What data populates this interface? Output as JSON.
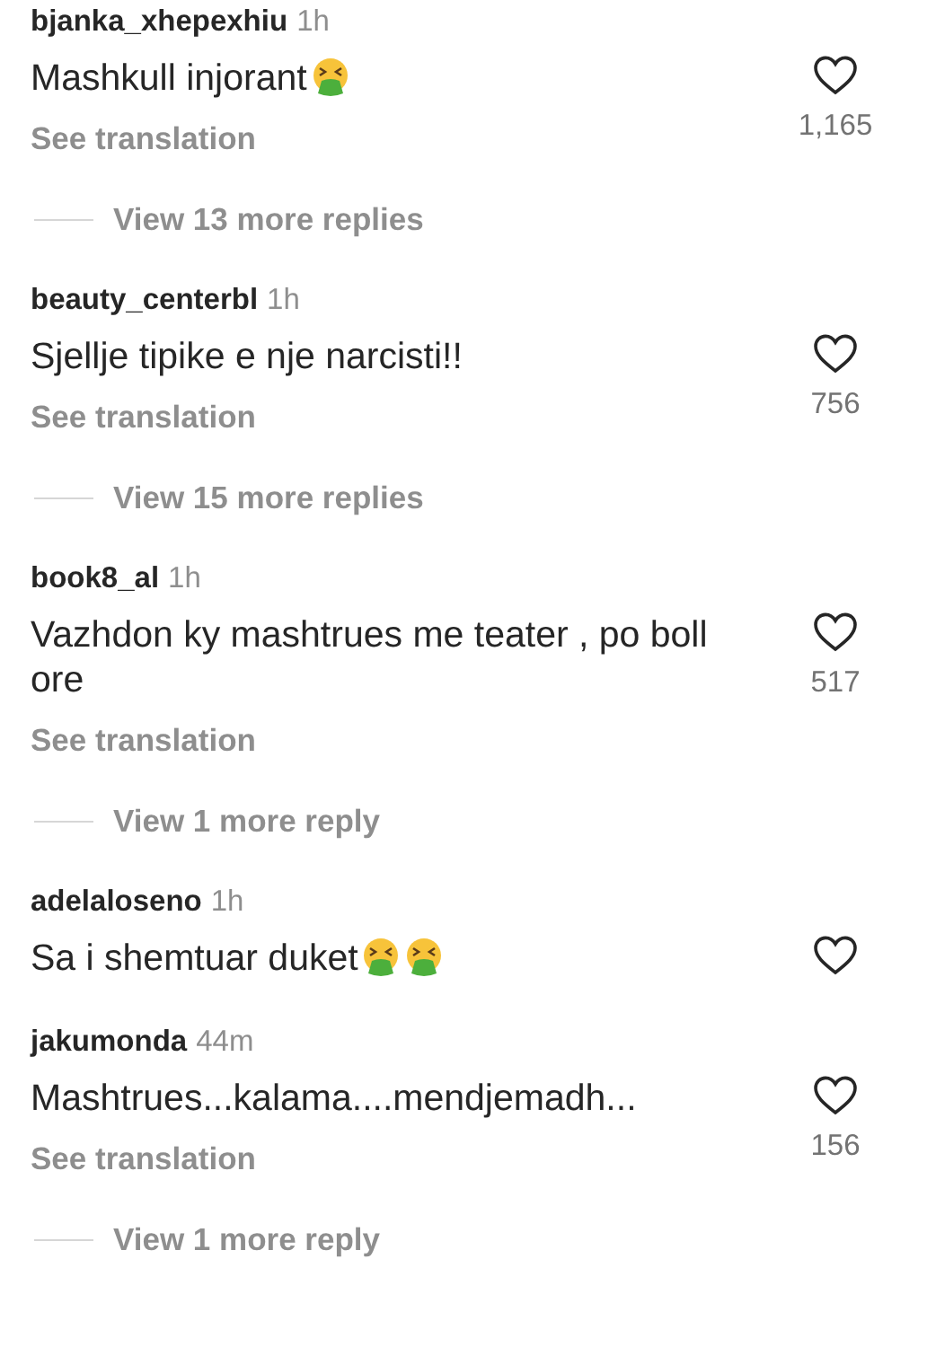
{
  "comments": [
    {
      "username": "bjanka_xhepexhiu",
      "time": "1h",
      "text": "Mashkull injorant",
      "emoji_icons": [
        {
          "kind": "vomit"
        }
      ],
      "liked": false,
      "likes": "1,165",
      "translation": "See translation",
      "replies": "View 13 more replies"
    },
    {
      "username": "beauty_centerbl",
      "time": "1h",
      "text": "Sjellje tipike e nje narcisti!!",
      "liked": false,
      "likes": "756",
      "translation": "See translation",
      "replies": "View 15 more replies"
    },
    {
      "username": "book8_al",
      "time": "1h",
      "text": "Vazhdon ky mashtrues me teater , po boll ore",
      "liked": false,
      "likes": "517",
      "translation": "See translation",
      "replies": "View 1 more reply"
    },
    {
      "username": "adelaloseno",
      "time": "1h",
      "text": "Sa i shemtuar duket",
      "emoji_icons": [
        {
          "kind": "vomit"
        },
        {
          "kind": "vomit"
        }
      ],
      "liked": false
    },
    {
      "username": "jakumonda",
      "time": "44m",
      "text": "Mashtrues...kalama....mendjemadh...",
      "liked": false,
      "likes": "156",
      "translation": "See translation",
      "replies": "View 1 more reply"
    }
  ]
}
